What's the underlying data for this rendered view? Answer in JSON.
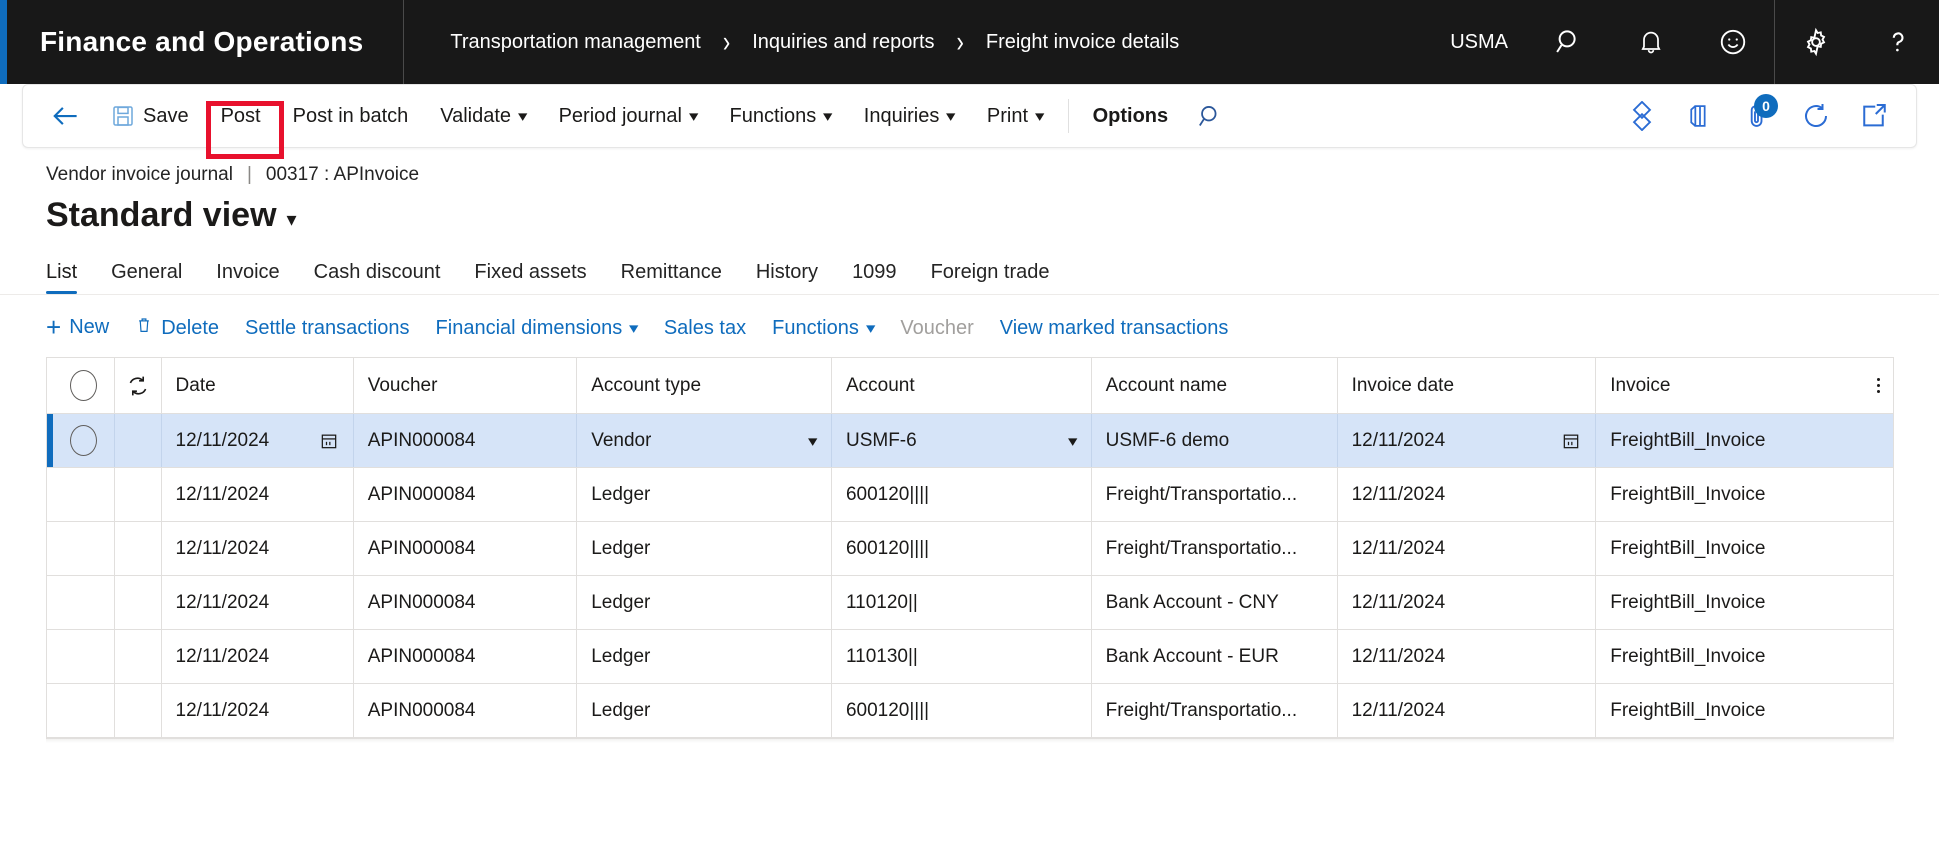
{
  "topbar": {
    "app_title": "Finance and Operations",
    "breadcrumb": [
      "Transportation management",
      "Inquiries and reports",
      "Freight invoice details"
    ],
    "company": "USMA",
    "icons": [
      "search-icon",
      "notification-bell-icon",
      "feedback-smiley-icon",
      "settings-gear-icon",
      "help-question-icon"
    ],
    "accent_color": "#0f6cbd",
    "background_color": "#181818"
  },
  "toolbar": {
    "back_label": "Back",
    "save_label": "Save",
    "post_label": "Post",
    "post_in_batch_label": "Post in batch",
    "validate_label": "Validate",
    "period_journal_label": "Period journal",
    "functions_label": "Functions",
    "inquiries_label": "Inquiries",
    "print_label": "Print",
    "options_label": "Options",
    "search_label": "Search",
    "attachment_count": "0",
    "right_icons": [
      "relationship-diamond-icon",
      "open-in-office-icon",
      "attachments-icon",
      "refresh-icon",
      "open-in-new-window-icon"
    ],
    "highlight_target": "Post",
    "highlight_color": "#e8112d"
  },
  "page": {
    "record_type": "Vendor invoice journal",
    "separator": "|",
    "record_id": "00317 : APInvoice",
    "view_title": "Standard view"
  },
  "tabs": [
    {
      "label": "List",
      "active": true
    },
    {
      "label": "General",
      "active": false
    },
    {
      "label": "Invoice",
      "active": false
    },
    {
      "label": "Cash discount",
      "active": false
    },
    {
      "label": "Fixed assets",
      "active": false
    },
    {
      "label": "Remittance",
      "active": false
    },
    {
      "label": "History",
      "active": false
    },
    {
      "label": "1099",
      "active": false
    },
    {
      "label": "Foreign trade",
      "active": false
    }
  ],
  "commands": [
    {
      "label": "New",
      "icon": "plus-icon",
      "disabled": false,
      "caret": false
    },
    {
      "label": "Delete",
      "icon": "trash-icon",
      "disabled": false,
      "caret": false
    },
    {
      "label": "Settle transactions",
      "icon": "",
      "disabled": false,
      "caret": false
    },
    {
      "label": "Financial dimensions",
      "icon": "",
      "disabled": false,
      "caret": true
    },
    {
      "label": "Sales tax",
      "icon": "",
      "disabled": false,
      "caret": false
    },
    {
      "label": "Functions",
      "icon": "",
      "disabled": false,
      "caret": true
    },
    {
      "label": "Voucher",
      "icon": "",
      "disabled": true,
      "caret": false
    },
    {
      "label": "View marked transactions",
      "icon": "",
      "disabled": false,
      "caret": false
    }
  ],
  "grid": {
    "columns": [
      {
        "key": "mark",
        "label": "",
        "icon": "select-all-circle-icon"
      },
      {
        "key": "sync",
        "label": "",
        "icon": "sync-refresh-icon"
      },
      {
        "key": "date",
        "label": "Date"
      },
      {
        "key": "voucher",
        "label": "Voucher"
      },
      {
        "key": "account_type",
        "label": "Account type"
      },
      {
        "key": "account",
        "label": "Account"
      },
      {
        "key": "account_name",
        "label": "Account name"
      },
      {
        "key": "invoice_date",
        "label": "Invoice date"
      },
      {
        "key": "invoice",
        "label": "Invoice"
      }
    ],
    "options_icon": "column-options-icon",
    "rows": [
      {
        "selected": true,
        "date": "12/11/2024",
        "voucher": "APIN000084",
        "account_type": "Vendor",
        "account": "USMF-6",
        "account_name": "USMF-6 demo",
        "invoice_date": "12/11/2024",
        "invoice": "FreightBill_Invoice",
        "date_has_calendar": true,
        "invoice_date_has_calendar": true,
        "account_type_has_dropdown": true,
        "account_has_dropdown": true
      },
      {
        "selected": false,
        "date": "12/11/2024",
        "voucher": "APIN000084",
        "account_type": "Ledger",
        "account": "600120||||",
        "account_name": "Freight/Transportatio...",
        "invoice_date": "12/11/2024",
        "invoice": "FreightBill_Invoice",
        "date_has_calendar": false,
        "invoice_date_has_calendar": false,
        "account_type_has_dropdown": false,
        "account_has_dropdown": false
      },
      {
        "selected": false,
        "date": "12/11/2024",
        "voucher": "APIN000084",
        "account_type": "Ledger",
        "account": "600120||||",
        "account_name": "Freight/Transportatio...",
        "invoice_date": "12/11/2024",
        "invoice": "FreightBill_Invoice",
        "date_has_calendar": false,
        "invoice_date_has_calendar": false,
        "account_type_has_dropdown": false,
        "account_has_dropdown": false
      },
      {
        "selected": false,
        "date": "12/11/2024",
        "voucher": "APIN000084",
        "account_type": "Ledger",
        "account": "110120||",
        "account_name": "Bank Account - CNY",
        "invoice_date": "12/11/2024",
        "invoice": "FreightBill_Invoice",
        "date_has_calendar": false,
        "invoice_date_has_calendar": false,
        "account_type_has_dropdown": false,
        "account_has_dropdown": false
      },
      {
        "selected": false,
        "date": "12/11/2024",
        "voucher": "APIN000084",
        "account_type": "Ledger",
        "account": "110130||",
        "account_name": "Bank Account - EUR",
        "invoice_date": "12/11/2024",
        "invoice": "FreightBill_Invoice",
        "date_has_calendar": false,
        "invoice_date_has_calendar": false,
        "account_type_has_dropdown": false,
        "account_has_dropdown": false
      },
      {
        "selected": false,
        "date": "12/11/2024",
        "voucher": "APIN000084",
        "account_type": "Ledger",
        "account": "600120||||",
        "account_name": "Freight/Transportatio...",
        "invoice_date": "12/11/2024",
        "invoice": "FreightBill_Invoice",
        "date_has_calendar": false,
        "invoice_date_has_calendar": false,
        "account_type_has_dropdown": false,
        "account_has_dropdown": false
      }
    ]
  }
}
